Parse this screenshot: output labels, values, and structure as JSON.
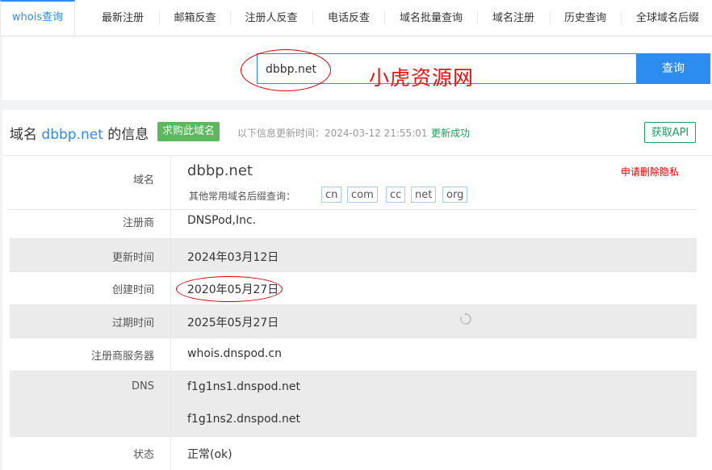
{
  "tabs": [
    {
      "label": "whois查询"
    },
    {
      "label": "最新注册"
    },
    {
      "label": "邮箱反查"
    },
    {
      "label": "注册人反查"
    },
    {
      "label": "电话反查"
    },
    {
      "label": "域名批量查询"
    },
    {
      "label": "域名注册"
    },
    {
      "label": "历史查询"
    },
    {
      "label": "全球域名后缀"
    }
  ],
  "search": {
    "value": "dbbp.net",
    "button": "查询"
  },
  "watermark": "小虎资源网",
  "header": {
    "title_prefix": "域名",
    "domain": "dbbp.net",
    "title_suffix": "的信息",
    "buy_button": "求购此域名",
    "update_time": "以下信息更新时间：2024-03-12 21:55:01",
    "update_status": "更新成功",
    "api_button": "获取API"
  },
  "details": {
    "domain": {
      "label": "域名",
      "value": "dbbp.net",
      "privacy": "申请删除隐私",
      "suffix_label": "其他常用域名后缀查询：",
      "suffixes": [
        "cn",
        "com",
        "cc",
        "net",
        "org"
      ]
    },
    "registrar": {
      "label": "注册商",
      "value": "DNSPod,Inc."
    },
    "updated": {
      "label": "更新时间",
      "value": "2024年03月12日"
    },
    "created": {
      "label": "创建时间",
      "value": "2020年05月27日"
    },
    "expires": {
      "label": "过期时间",
      "value": "2025年05月27日"
    },
    "whois_server": {
      "label": "注册商服务器",
      "value": "whois.dnspod.cn"
    },
    "dns": {
      "label": "DNS",
      "values": [
        "f1g1ns1.dnspod.net",
        "f1g1ns2.dnspod.net"
      ]
    },
    "status": {
      "label": "状态",
      "value": "正常(ok)"
    }
  },
  "colors": {
    "accent": "#2d8cf0",
    "success": "#19a15f",
    "buy": "#5cb85c",
    "annotation": "#dd0000"
  }
}
